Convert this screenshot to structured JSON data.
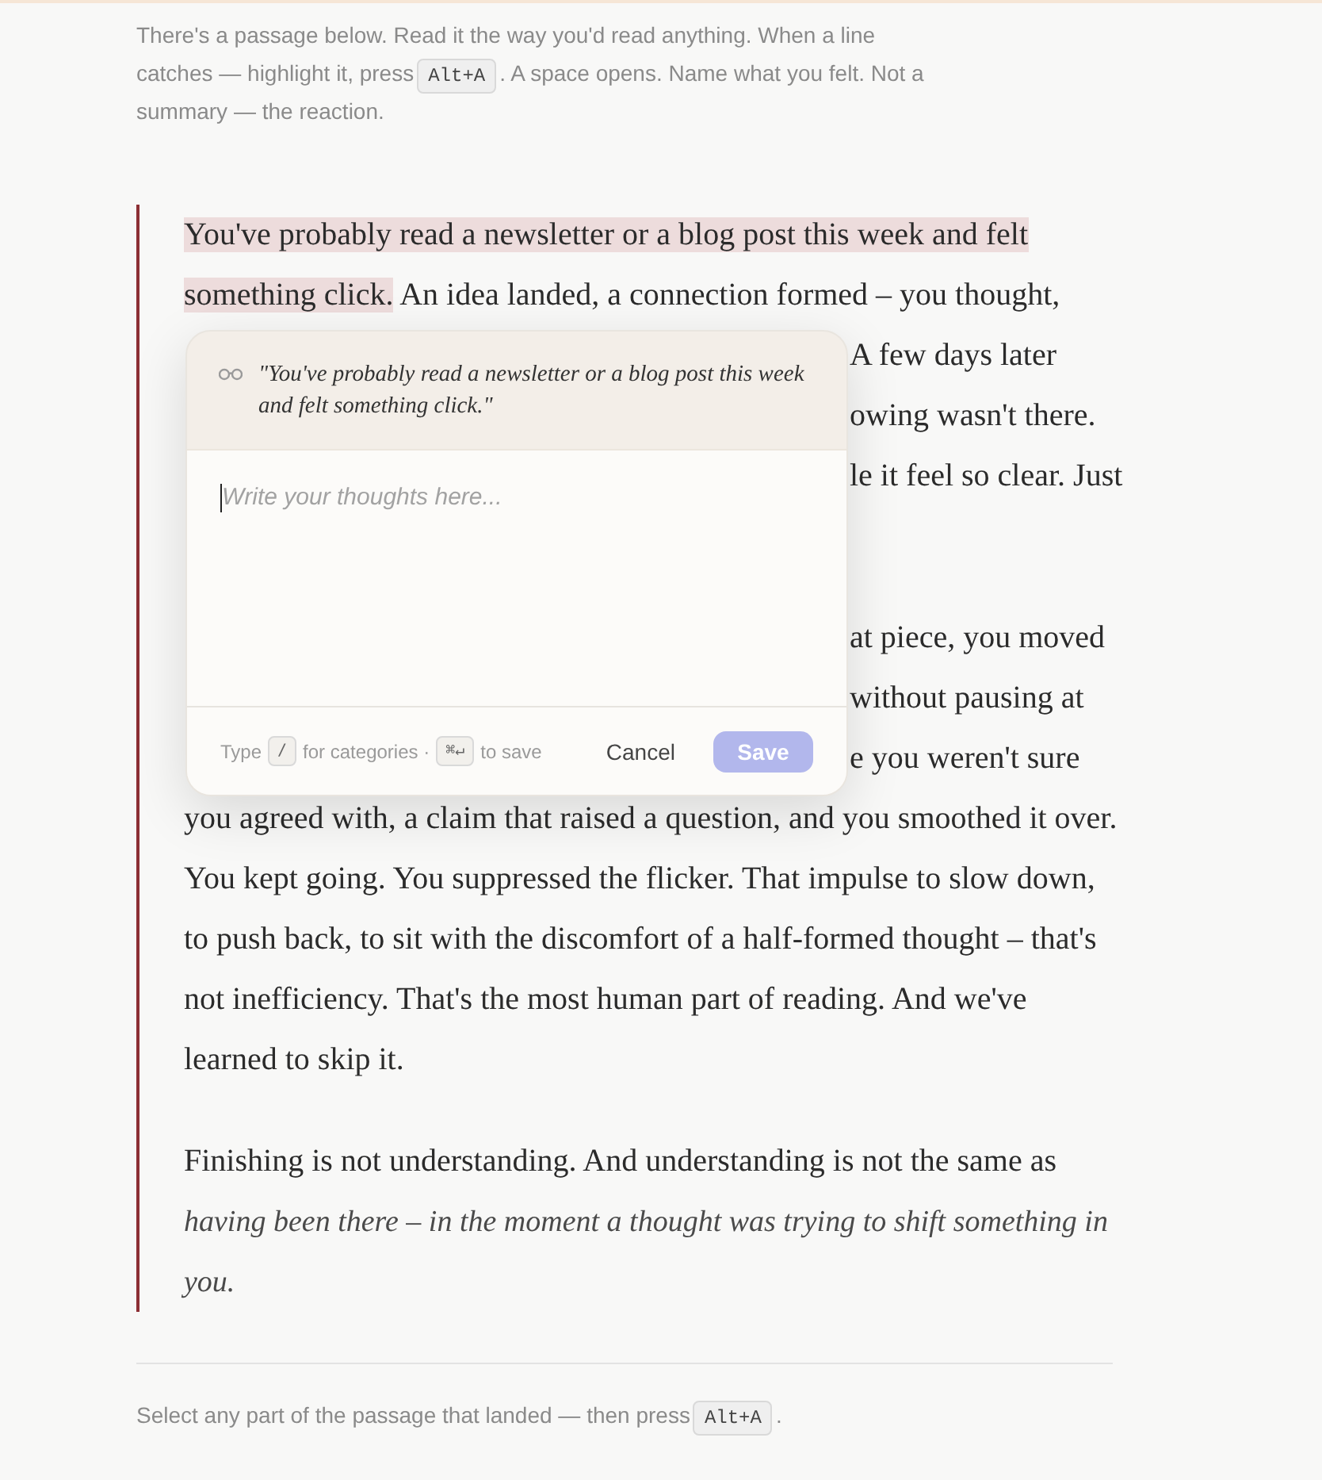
{
  "intro": {
    "lines": [
      {
        "parts": [
          {
            "kind": "text",
            "text": "There's a passage below. Read it the way you'd read anything. When a line"
          }
        ]
      },
      {
        "parts": [
          {
            "kind": "text",
            "text": "catches — highlight it, press"
          },
          {
            "kind": "key",
            "text": "Alt+A"
          },
          {
            "kind": "text",
            "text": ". A space opens. Name what you felt. Not a"
          }
        ]
      },
      {
        "parts": [
          {
            "kind": "text",
            "text": "summary — the reaction."
          }
        ]
      }
    ]
  },
  "passage": {
    "paragraphs": [
      {
        "lines": [
          {
            "kind": "full",
            "parts": [
              {
                "text": "You've probably read a newsletter or a blog post this week and felt",
                "highlighted": true,
                "italic": false
              }
            ]
          },
          {
            "kind": "full",
            "parts": [
              {
                "text": "something click.",
                "highlighted": true,
                "italic": false
              },
              {
                "text": " An idea landed, a connection formed – you thought,",
                "highlighted": false,
                "italic": false
              }
            ]
          },
          {
            "kind": "fragment",
            "parts": [
              {
                "text": "A few days later",
                "highlighted": false,
                "italic": false
              }
            ]
          },
          {
            "kind": "fragment",
            "parts": [
              {
                "text": "owing wasn't there.",
                "highlighted": false,
                "italic": false
              }
            ]
          },
          {
            "kind": "fragment",
            "parts": [
              {
                "text": "le it feel so clear. Just",
                "highlighted": false,
                "italic": false
              }
            ]
          }
        ]
      },
      {
        "lines": [
          {
            "kind": "fragment",
            "parts": [
              {
                "text": "at piece, you moved",
                "highlighted": false,
                "italic": false
              }
            ]
          },
          {
            "kind": "fragment",
            "parts": [
              {
                "text": "without pausing at",
                "highlighted": false,
                "italic": false
              }
            ]
          },
          {
            "kind": "fragment",
            "parts": [
              {
                "text": "e you weren't sure",
                "highlighted": false,
                "italic": false
              }
            ]
          },
          {
            "kind": "full",
            "parts": [
              {
                "text": "you agreed with, a claim that raised a question, and you smoothed it over.",
                "highlighted": false,
                "italic": false
              }
            ]
          },
          {
            "kind": "full",
            "parts": [
              {
                "text": "You kept going. You suppressed the flicker. That impulse to slow down,",
                "highlighted": false,
                "italic": false
              }
            ]
          },
          {
            "kind": "full",
            "parts": [
              {
                "text": "to push back, to sit with the discomfort of a half-formed thought – that's",
                "highlighted": false,
                "italic": false
              }
            ]
          },
          {
            "kind": "full",
            "parts": [
              {
                "text": "not inefficiency. That's the most human part of reading. And we've",
                "highlighted": false,
                "italic": false
              }
            ]
          },
          {
            "kind": "full",
            "parts": [
              {
                "text": "learned to skip it.",
                "highlighted": false,
                "italic": false
              }
            ]
          }
        ]
      },
      {
        "lines": [
          {
            "kind": "full",
            "parts": [
              {
                "text": "Finishing is not understanding. And understanding is not the same as",
                "highlighted": false,
                "italic": false
              }
            ]
          },
          {
            "kind": "full",
            "parts": [
              {
                "text": "having been there – in the moment a thought was trying to shift something in",
                "highlighted": false,
                "italic": true
              }
            ]
          },
          {
            "kind": "full",
            "parts": [
              {
                "text": "you.",
                "highlighted": false,
                "italic": true
              }
            ]
          }
        ]
      }
    ]
  },
  "popover": {
    "quote": "\"You've probably read a newsletter or a blog post this week and felt something click.\"",
    "field": {
      "placeholder": "Write your thoughts here..."
    },
    "hint": [
      {
        "kind": "text",
        "text": "Type"
      },
      {
        "kind": "key",
        "text": "/"
      },
      {
        "kind": "text",
        "text": "for categories ·"
      },
      {
        "kind": "key",
        "text": "⌘↵"
      },
      {
        "kind": "text",
        "text": "to save"
      }
    ],
    "cancel_button": {
      "label": "Cancel"
    },
    "save_button": {
      "label": "Save",
      "disabled": true
    }
  },
  "footer": {
    "parts": [
      {
        "kind": "text",
        "text": "Select any part of the passage that landed — then press"
      },
      {
        "kind": "key",
        "text": "Alt+A"
      },
      {
        "kind": "text",
        "text": "."
      }
    ]
  }
}
